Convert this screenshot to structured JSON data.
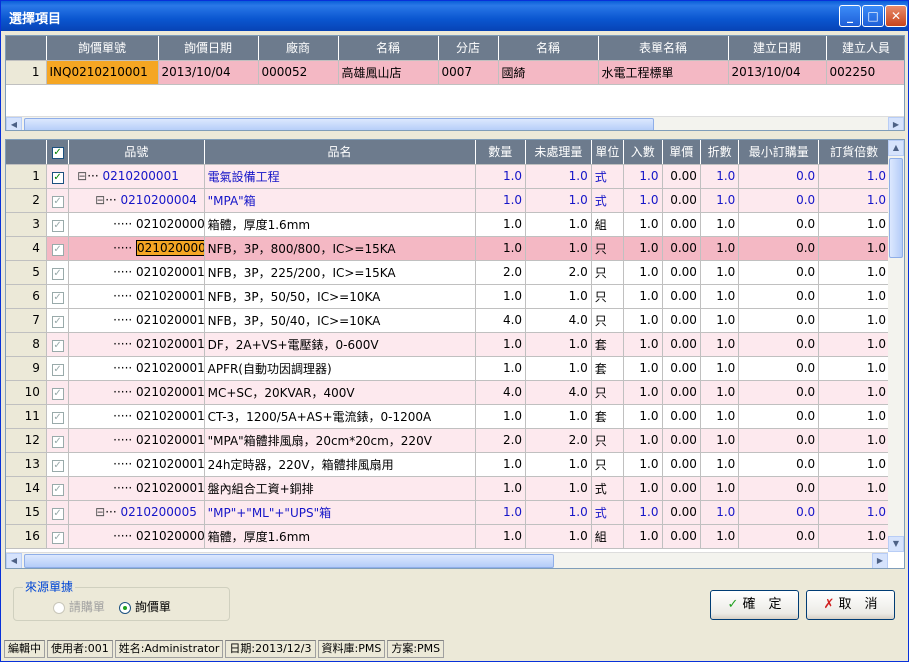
{
  "window": {
    "title": "選擇項目",
    "minimize": "_",
    "maximize": "□",
    "close": "✕"
  },
  "top_grid": {
    "headers": [
      "詢價單號",
      "詢價日期",
      "廠商",
      "名稱",
      "分店",
      "名稱",
      "表單名稱",
      "建立日期",
      "建立人員"
    ],
    "rows": [
      {
        "n": "1",
        "cells": [
          "INQ0210210001",
          "2013/10/04",
          "000052",
          "高雄鳳山店",
          "0007",
          "國綺",
          "水電工程標單",
          "2013/10/04",
          "002250"
        ]
      }
    ]
  },
  "item_grid": {
    "headers": [
      "品號",
      "品名",
      "數量",
      "未處理量",
      "單位",
      "入數",
      "單價",
      "折數",
      "最小訂購量",
      "訂貨倍數"
    ],
    "rows": [
      {
        "n": "1",
        "lvl": 0,
        "exp": "⊟",
        "checked": true,
        "code": "0210200001",
        "name": "電氣設備工程",
        "qty": "1.0",
        "pend": "1.0",
        "unit": "式",
        "inn": "1.0",
        "price": "0.00",
        "disc": "1.0",
        "min": "0.0",
        "mult": "1.0",
        "style": "group"
      },
      {
        "n": "2",
        "lvl": 1,
        "exp": "⊟",
        "checked": false,
        "code": "0210200004",
        "name": "\"MPA\"箱",
        "qty": "1.0",
        "pend": "1.0",
        "unit": "式",
        "inn": "1.0",
        "price": "0.00",
        "disc": "1.0",
        "min": "0.0",
        "mult": "1.0",
        "style": "group"
      },
      {
        "n": "3",
        "lvl": 2,
        "exp": "",
        "checked": false,
        "code": "0210200008",
        "name": "箱體，厚度1.6mm",
        "qty": "1.0",
        "pend": "1.0",
        "unit": "組",
        "inn": "1.0",
        "price": "0.00",
        "disc": "1.0",
        "min": "0.0",
        "mult": "1.0",
        "style": ""
      },
      {
        "n": "4",
        "lvl": 2,
        "exp": "",
        "checked": false,
        "code": "0210200009",
        "name": "NFB，3P，800/800，IC>=15KA",
        "qty": "1.0",
        "pend": "1.0",
        "unit": "只",
        "inn": "1.0",
        "price": "0.00",
        "disc": "1.0",
        "min": "0.0",
        "mult": "1.0",
        "style": "sel"
      },
      {
        "n": "5",
        "lvl": 2,
        "exp": "",
        "checked": false,
        "code": "0210200010",
        "name": "NFB，3P，225/200，IC>=15KA",
        "qty": "2.0",
        "pend": "2.0",
        "unit": "只",
        "inn": "1.0",
        "price": "0.00",
        "disc": "1.0",
        "min": "0.0",
        "mult": "1.0",
        "style": ""
      },
      {
        "n": "6",
        "lvl": 2,
        "exp": "",
        "checked": false,
        "code": "0210200011",
        "name": "NFB，3P，50/50，IC>=10KA",
        "qty": "1.0",
        "pend": "1.0",
        "unit": "只",
        "inn": "1.0",
        "price": "0.00",
        "disc": "1.0",
        "min": "0.0",
        "mult": "1.0",
        "style": ""
      },
      {
        "n": "7",
        "lvl": 2,
        "exp": "",
        "checked": false,
        "code": "0210200012",
        "name": "NFB，3P，50/40，IC>=10KA",
        "qty": "4.0",
        "pend": "4.0",
        "unit": "只",
        "inn": "1.0",
        "price": "0.00",
        "disc": "1.0",
        "min": "0.0",
        "mult": "1.0",
        "style": ""
      },
      {
        "n": "8",
        "lvl": 2,
        "exp": "",
        "checked": false,
        "code": "0210200013",
        "name": "DF，2A+VS+電壓錶，0-600V",
        "qty": "1.0",
        "pend": "1.0",
        "unit": "套",
        "inn": "1.0",
        "price": "0.00",
        "disc": "1.0",
        "min": "0.0",
        "mult": "1.0",
        "style": "pink"
      },
      {
        "n": "9",
        "lvl": 2,
        "exp": "",
        "checked": false,
        "code": "0210200014",
        "name": "APFR(自動功因調理器)",
        "qty": "1.0",
        "pend": "1.0",
        "unit": "套",
        "inn": "1.0",
        "price": "0.00",
        "disc": "1.0",
        "min": "0.0",
        "mult": "1.0",
        "style": ""
      },
      {
        "n": "10",
        "lvl": 2,
        "exp": "",
        "checked": false,
        "code": "0210200015",
        "name": "MC+SC，20KVAR，400V",
        "qty": "4.0",
        "pend": "4.0",
        "unit": "只",
        "inn": "1.0",
        "price": "0.00",
        "disc": "1.0",
        "min": "0.0",
        "mult": "1.0",
        "style": "pink"
      },
      {
        "n": "11",
        "lvl": 2,
        "exp": "",
        "checked": false,
        "code": "0210200016",
        "name": "CT-3，1200/5A+AS+電流錶，0-1200A",
        "qty": "1.0",
        "pend": "1.0",
        "unit": "套",
        "inn": "1.0",
        "price": "0.00",
        "disc": "1.0",
        "min": "0.0",
        "mult": "1.0",
        "style": ""
      },
      {
        "n": "12",
        "lvl": 2,
        "exp": "",
        "checked": false,
        "code": "0210200017",
        "name": "\"MPA\"箱體排風扇，20cm*20cm，220V",
        "qty": "2.0",
        "pend": "2.0",
        "unit": "只",
        "inn": "1.0",
        "price": "0.00",
        "disc": "1.0",
        "min": "0.0",
        "mult": "1.0",
        "style": "pink"
      },
      {
        "n": "13",
        "lvl": 2,
        "exp": "",
        "checked": false,
        "code": "0210200018",
        "name": "24h定時器，220V，箱體排風扇用",
        "qty": "1.0",
        "pend": "1.0",
        "unit": "只",
        "inn": "1.0",
        "price": "0.00",
        "disc": "1.0",
        "min": "0.0",
        "mult": "1.0",
        "style": ""
      },
      {
        "n": "14",
        "lvl": 2,
        "exp": "",
        "checked": false,
        "code": "0210200019",
        "name": "盤內組合工資+銅排",
        "qty": "1.0",
        "pend": "1.0",
        "unit": "式",
        "inn": "1.0",
        "price": "0.00",
        "disc": "1.0",
        "min": "0.0",
        "mult": "1.0",
        "style": "pink"
      },
      {
        "n": "15",
        "lvl": 1,
        "exp": "⊟",
        "checked": false,
        "code": "0210200005",
        "name": "\"MP\"+\"ML\"+\"UPS\"箱",
        "qty": "1.0",
        "pend": "1.0",
        "unit": "式",
        "inn": "1.0",
        "price": "0.00",
        "disc": "1.0",
        "min": "0.0",
        "mult": "1.0",
        "style": "group"
      },
      {
        "n": "16",
        "lvl": 2,
        "exp": "",
        "checked": false,
        "code": "0210200008",
        "name": "箱體，厚度1.6mm",
        "qty": "1.0",
        "pend": "1.0",
        "unit": "組",
        "inn": "1.0",
        "price": "0.00",
        "disc": "1.0",
        "min": "0.0",
        "mult": "1.0",
        "style": "pink"
      }
    ]
  },
  "source": {
    "legend": "來源單據",
    "options": [
      {
        "label": "請購單",
        "selected": false,
        "disabled": true
      },
      {
        "label": "詢價單",
        "selected": true,
        "disabled": false
      }
    ]
  },
  "buttons": {
    "ok": "確　定",
    "cancel": "取　消",
    "ok_icon": "✓",
    "cancel_icon": "✗"
  },
  "statusbar": [
    "編輯中",
    "使用者:001",
    "姓名:Administrator",
    "日期:2013/12/3",
    "資料庫:PMS",
    "方案:PMS"
  ],
  "colors": {
    "header": "#6D7B8D",
    "selected_row": "#F4B8C4",
    "alt_row": "#FDE9EE",
    "current_cell": "#F5A623",
    "link_blue": "#1515C8"
  }
}
